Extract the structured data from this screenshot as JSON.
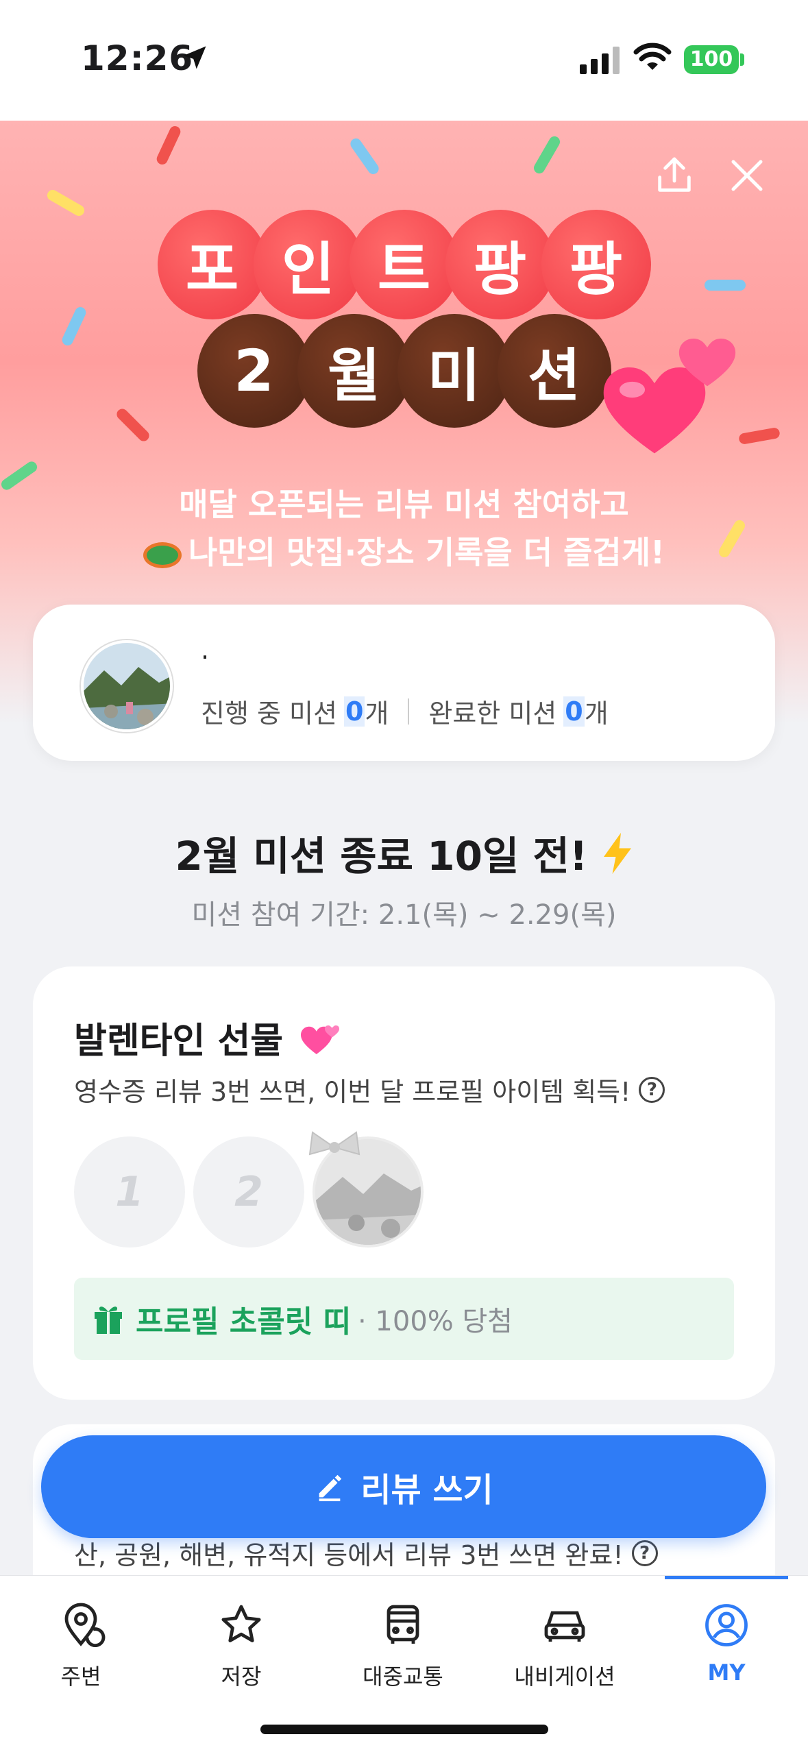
{
  "status_bar": {
    "time": "12:26",
    "battery": "100"
  },
  "hero": {
    "title_row1": [
      "포",
      "인",
      "트",
      "팡",
      "팡"
    ],
    "title_row2": [
      "2",
      "월",
      "미",
      "션"
    ],
    "subtitle_line1": "매달 오픈되는 리뷰 미션 참여하고",
    "subtitle_line2": "나만의 맛집·장소 기록을 더 즐겁게!"
  },
  "profile": {
    "nickname": ".",
    "in_progress_label": "진행 중 미션",
    "in_progress_count": "0",
    "completed_label": "완료한 미션",
    "completed_count": "0",
    "unit": "개"
  },
  "mission": {
    "title": "2월 미션 종료 10일 전!",
    "period": "미션 참여 기간: 2.1(목) ~ 2.29(목)"
  },
  "valentine_card": {
    "title": "발렌타인 선물",
    "description": "영수증 리뷰 3번 쓰면, 이번 달 프로필 아이템 획득!",
    "steps": [
      "1",
      "2"
    ],
    "prize_name": "프로필 초콜릿 띠",
    "prize_rate": "· 100% 당첨"
  },
  "next_card": {
    "description": "산, 공원, 해변, 유적지 등에서 리뷰 3번 쓰면 완료!"
  },
  "review_button": {
    "label": "리뷰 쓰기"
  },
  "tab_bar": {
    "tabs": [
      {
        "label": "주변",
        "icon": "map-pin-icon"
      },
      {
        "label": "저장",
        "icon": "star-icon"
      },
      {
        "label": "대중교통",
        "icon": "bus-icon"
      },
      {
        "label": "내비게이션",
        "icon": "car-icon"
      },
      {
        "label": "MY",
        "icon": "user-icon"
      }
    ],
    "active_index": 4
  },
  "colors": {
    "accent": "#2f7cf6",
    "prize_green": "#1ba25c",
    "title_red": "#f03a45",
    "title_brown": "#4d2414"
  }
}
